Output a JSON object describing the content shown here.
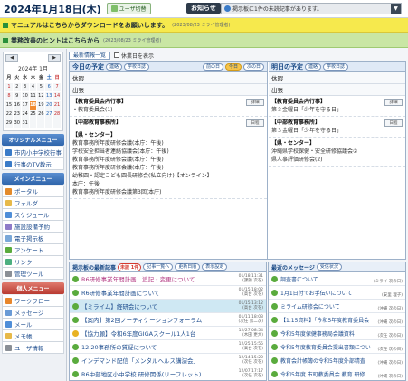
{
  "header": {
    "date": "2024年1月18日(木)",
    "user_button": "ユーザ切替",
    "notice_label": "お知らせ",
    "notice_text": "掲示板に1件の未読記事があります。",
    "dropdown": "▼"
  },
  "banners": [
    {
      "text": "マニュアルはこちらからダウンロードをお願いします。",
      "sub": "(2023/08/23 ミライ管理者)"
    },
    {
      "text": "業務改善のヒントはこちらから",
      "sub": "(2023/08/23 ミライ管理者)"
    }
  ],
  "calendar": {
    "prev": "◀",
    "next": "▶",
    "title": "2024年 1月",
    "weekdays": [
      "月",
      "火",
      "水",
      "木",
      "金",
      "土",
      "日"
    ],
    "weeks": [
      [
        "1",
        "2",
        "3",
        "4",
        "5",
        "6",
        "7"
      ],
      [
        "8",
        "9",
        "10",
        "11",
        "12",
        "13",
        "14"
      ],
      [
        "15",
        "16",
        "17",
        "18",
        "19",
        "20",
        "21"
      ],
      [
        "22",
        "23",
        "24",
        "25",
        "26",
        "27",
        "28"
      ],
      [
        "29",
        "30",
        "31",
        "",
        "",
        "",
        ""
      ]
    ]
  },
  "sidebar": {
    "orig_menu_title": "オリジナルメニュー",
    "orig_items": [
      {
        "label": "市内小中学校行事",
        "color": "#3a7bc8"
      },
      {
        "label": "行事のTV教示",
        "color": "#3a7bc8"
      }
    ],
    "main_menu_title": "メインメニュー",
    "main_items": [
      {
        "label": "ポータル",
        "color": "#e38a2b"
      },
      {
        "label": "フォルダ",
        "color": "#e7b949"
      },
      {
        "label": "スケジュール",
        "color": "#4f8ed8"
      },
      {
        "label": "施設設備予約",
        "color": "#8e7bc8"
      },
      {
        "label": "電子掲示板",
        "color": "#7aa8d8"
      },
      {
        "label": "アンケート",
        "color": "#5aab3d"
      },
      {
        "label": "リンク",
        "color": "#4caf80"
      },
      {
        "label": "管理ツール",
        "color": "#8a8f96"
      }
    ],
    "personal_menu_title": "個人メニュー",
    "personal_items": [
      {
        "label": "ワークフロー",
        "color": "#e8862b"
      },
      {
        "label": "メッセージ",
        "color": "#6a9bd6"
      },
      {
        "label": "メール",
        "color": "#4f8ed8"
      },
      {
        "label": "メモ帳",
        "color": "#e7b949"
      },
      {
        "label": "ユーザ情報",
        "color": "#8a8f96"
      }
    ]
  },
  "main": {
    "tab_label": "最新情報一覧",
    "checkbox_label": "休業日を表示",
    "today": {
      "title": "今日の予定",
      "pills": [
        "連絡",
        "学校日誌",
        "前の日",
        "今日",
        "次の日"
      ],
      "rows": [
        "休暇",
        "出張"
      ],
      "events": [
        {
          "head": "【教育委員会内行事】",
          "lines": [
            "・教育委員会(1)"
          ],
          "btn": "詳細"
        },
        {
          "head": "【中部教育事務所】",
          "lines": [],
          "btn": "日程"
        },
        {
          "head": "【県・センター】",
          "lines": [
            "教育事務所年度研修会議(本庁：午後)",
            "学校安全担当者連絡協議会(本庁：午後)",
            "教育事務所年度研修会議(本庁：午後)",
            "教育事務所年度研修会議(本庁：午後)",
            "幼稚園・認定こども園長研修会(私立向け)【オンライン】",
            "本庁：午後",
            "教育事務所年度研修会議第3回(本庁)"
          ],
          "btn": ""
        }
      ]
    },
    "tomorrow": {
      "title": "明日の予定",
      "pills": [
        "連絡",
        "学校日誌"
      ],
      "rows": [
        "休暇",
        "出張"
      ],
      "events": [
        {
          "head": "【教育委員会内行事】",
          "lines": [
            "第３金曜日「少年を守る日」"
          ],
          "btn": "詳細"
        },
        {
          "head": "【中部教育事務所】",
          "lines": [
            "第３金曜日「少年を守る日」"
          ],
          "btn": "日程"
        },
        {
          "head": "【県・センター】",
          "lines": [
            "沖縄県学校保健・安全研修協議会②",
            "県人事評価研修会(2)"
          ],
          "btn": ""
        }
      ]
    },
    "board": {
      "title": "掲示板の最新記事",
      "badge": "未読 1件",
      "pills": [
        "記事一覧へ",
        "更新日順",
        "表示設定"
      ],
      "posts": [
        {
          "title": "R6研修事業年間計画　追記・変更について",
          "meta": "01/18 11:31\n(課題 次を)",
          "pink": true,
          "hl": false
        },
        {
          "title": "R6研修事業年間計画について",
          "meta": "01/15 18:02\n(高台 次を)",
          "pink": false,
          "hl": false
        },
        {
          "title": "【ミライム】経研会について",
          "meta": "01/15 13:12\n(高台 次を)",
          "pink": false,
          "hl": true
        },
        {
          "title": "【案内】第2回ノーティケーションフォーラム",
          "meta": "01/11 18:03\n(次任 第二次)",
          "pink": false,
          "hl": false
        },
        {
          "title": "【協力願】令和6年度GIGAスクール1人1台",
          "meta": "12/27 08:54\n(木田 更大)",
          "pink": false,
          "hl": false
        },
        {
          "title": "12.20事務所の質疑について",
          "meta": "12/25 15:55\n(高台 次を)",
          "pink": false,
          "hl": false
        },
        {
          "title": "インデマンド配信「メンタルヘルス講演会」",
          "meta": "12/14 15:20\n(次任 次を)",
          "pink": false,
          "hl": false
        },
        {
          "title": "R6中部地区小中学校 研修関係(リーフレット)",
          "meta": "12/07 17:17\n(次任 次を)",
          "pink": false,
          "hl": false
        }
      ]
    },
    "messages": {
      "title": "最近のメッセージ",
      "pill": "受信状況",
      "items": [
        {
          "text": "調査書について",
          "meta": "(ミライ 次の日)"
        },
        {
          "text": "1月1日付でお手伝いについて",
          "meta": "(安里 理子)"
        },
        {
          "text": "ミライム研修会について",
          "meta": "(沖縄 次の日)"
        },
        {
          "text": "【1.15資料】「今和5年度教育委員会",
          "meta": "(沖縄 次の日)"
        },
        {
          "text": "今和5年度保健事務局会議資料",
          "meta": "(次任 次の日)"
        },
        {
          "text": "令和5年度教育委員会提出書類について",
          "meta": "(次任 次の日)"
        },
        {
          "text": "教育会計帳簿の令和5年度外部精査",
          "meta": "(沖縄 次の日)"
        },
        {
          "text": "令和5年度 市町教委員会 教育 研修",
          "meta": "(沖縄 次の日)"
        }
      ]
    }
  }
}
